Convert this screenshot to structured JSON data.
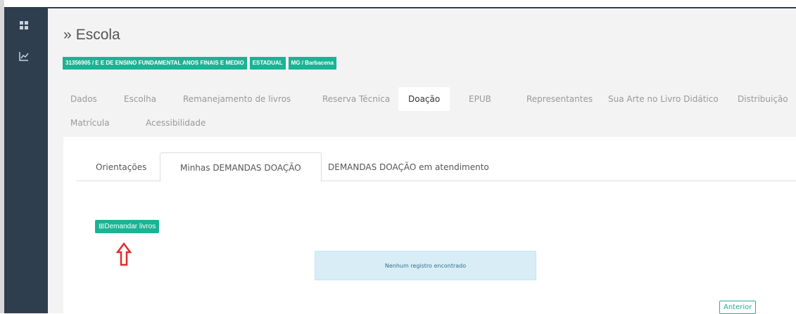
{
  "sidebar": {
    "items": [
      {
        "icon": "grid-icon"
      },
      {
        "icon": "chart-line-icon"
      }
    ]
  },
  "header": {
    "raquo": "»",
    "title": "Escola",
    "badges": [
      "31356905 / E E DE ENSINO FUNDAMENTAL ANOS FINAIS E MEDIO",
      "ESTADUAL",
      "MG / Barbacena"
    ]
  },
  "tabs": [
    {
      "label": "Dados"
    },
    {
      "label": "Escolha"
    },
    {
      "label": "Remanejamento de livros"
    },
    {
      "label": "Reserva Técnica"
    },
    {
      "label": "Doação",
      "active": true
    },
    {
      "label": "EPUB"
    },
    {
      "label": "Representantes"
    },
    {
      "label": "Sua Arte no Livro Didático"
    },
    {
      "label": "Distribuição"
    },
    {
      "label": "Matrícula"
    },
    {
      "label": "Acessibilidade"
    }
  ],
  "subtabs": [
    {
      "label": "Orientações"
    },
    {
      "label": "Minhas DEMANDAS DOAÇÃO",
      "active": true
    },
    {
      "label": "DEMANDAS DOAÇÃO em atendimento"
    }
  ],
  "actions": {
    "demandar_icon": "⊞",
    "demandar_label": "Demandar livros"
  },
  "empty_message": "Nenhum registro encontrado",
  "pagination": {
    "previous_label": "Anterior"
  },
  "colors": {
    "accent": "#1ab394",
    "sidebar": "#2f3e4e",
    "arrow": "#e32b2b",
    "info_bg": "#d9edf7"
  }
}
